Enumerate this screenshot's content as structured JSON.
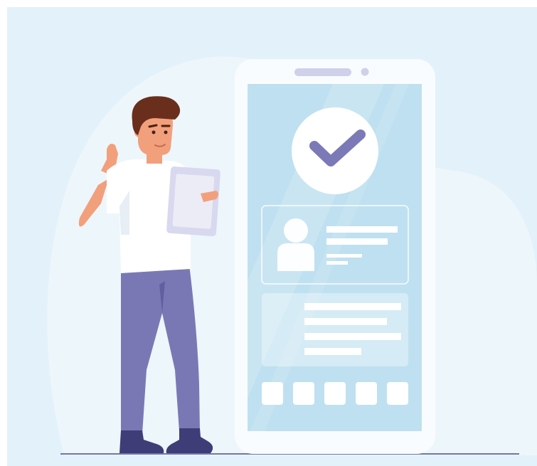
{
  "illustration": {
    "subject": "verified-profile-illustration",
    "icons": {
      "check": "checkmark-icon",
      "avatar": "user-avatar-icon"
    },
    "colors": {
      "background": "#e3f1fa",
      "blob": "#edf6fb",
      "phone_frame": "#f9fcfe",
      "phone_screen": "#bfe0f0",
      "accent_purple": "#7b79b6",
      "pants": "#7a78b4",
      "shoes": "#3f3d78",
      "hair": "#6a2f1c",
      "skin": "#f2a07c",
      "shirt": "#ffffff",
      "tablet": "#d8d8ef",
      "ground_line": "#6f78a8"
    }
  }
}
